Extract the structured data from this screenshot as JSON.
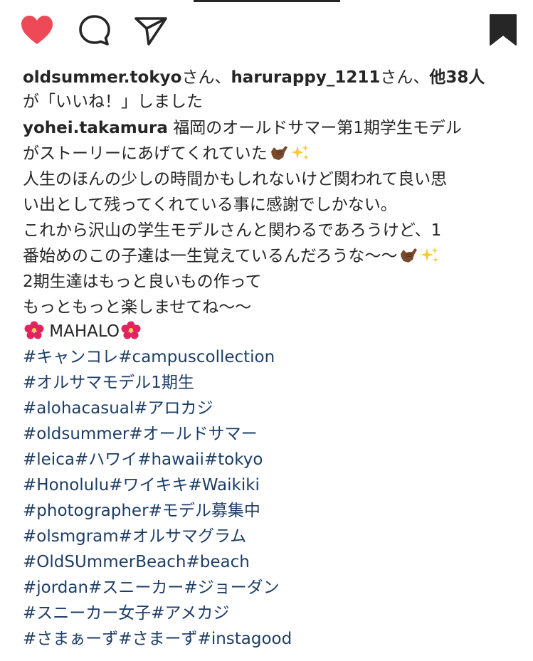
{
  "actions": {
    "like_color": "#ed4956",
    "icon_color": "#262626",
    "icons": [
      "heart-icon",
      "comment-icon",
      "share-icon",
      "bookmark-icon"
    ]
  },
  "likes": {
    "user1": "oldsummer.tokyo",
    "sep1": "さん、",
    "user2": "harurappy_1211",
    "sep2": "さん、",
    "others": "他38人",
    "line2": "が「いいね！」しました"
  },
  "caption": {
    "author": "yohei.takamura",
    "line1_text": " 福岡のオールドサマー第1期学生モデル",
    "line2_text": "がストーリーにあげてくれていた",
    "line3": "人生のほんの少しの時間かもしれないけど関われて良い思",
    "line4": "い出として残ってくれている事に感謝でしかない。",
    "line5": "これから沢山の学生モデルさんと関わるであろうけど、1",
    "line6_text": "番始めのこの子達は一生覚えているんだろうな〜〜",
    "line7": "2期生達はもっと良いもの作って",
    "line8": "もっともっと楽しませてね〜〜",
    "mahalo": " MAHALO"
  },
  "hashtags": [
    "#キャンコレ#campuscollection",
    "#オルサマモデル1期生",
    "#alohacasual#アロカジ",
    "#oldsummer#オールドサマー",
    "#leica#ハワイ#hawaii#tokyo",
    "#Honolulu#ワイキキ#Waikiki",
    "#photographer#モデル募集中",
    "#olsmgram#オルサマグラム",
    "#OldSUmmerBeach#beach",
    "#jordan#スニーカー#ジョーダン",
    "#スニーカー女子#アメカジ",
    "#さまぁーず#さまーず#instagood"
  ],
  "colors": {
    "hashtag": "#1e3e66",
    "text": "#262626"
  }
}
